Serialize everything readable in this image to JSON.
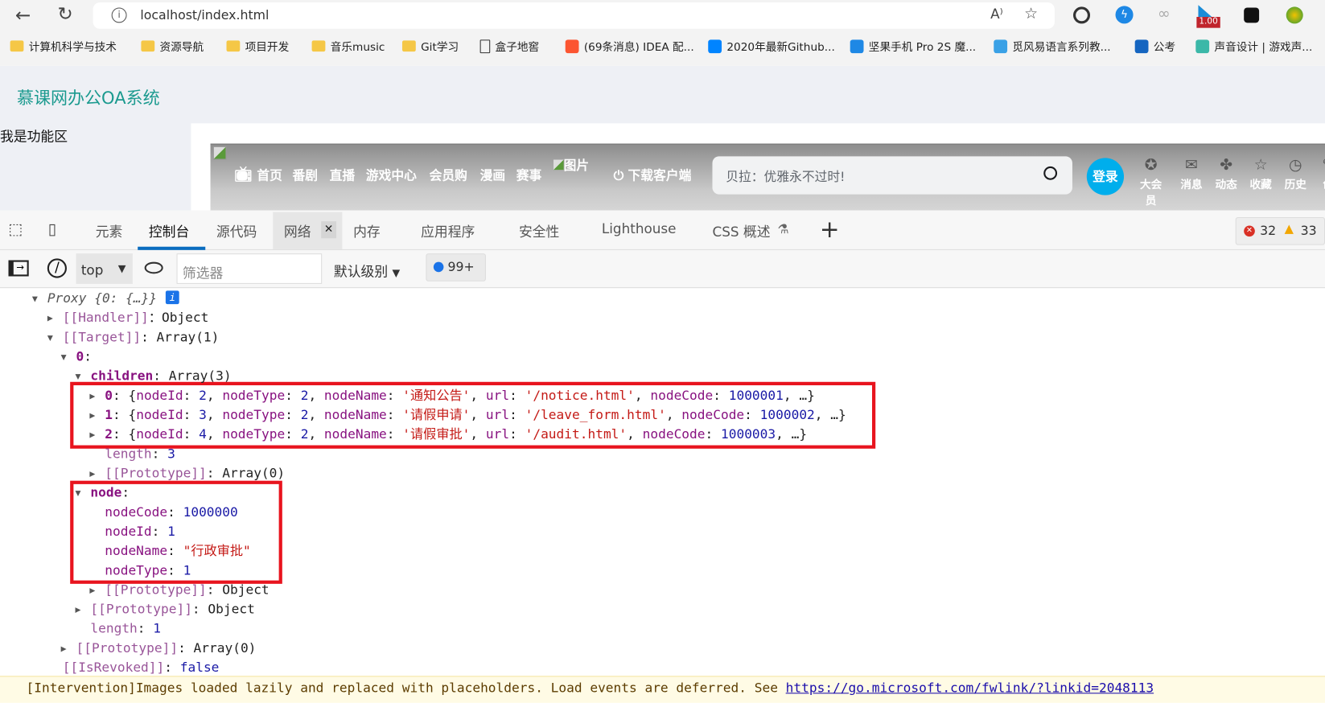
{
  "browser": {
    "url": "localhost/index.html",
    "ext_badge": "1.00",
    "bookmarks": [
      "计算机科学与技术",
      "资源导航",
      "项目开发",
      "音乐music",
      "Git学习",
      "盒子地窖",
      "(69条消息) IDEA 配...",
      "2020年最新Github...",
      "坚果手机 Pro 2S 魔...",
      "觅风易语言系列教...",
      "公考",
      "声音设计 | 游戏声..."
    ]
  },
  "page": {
    "title": "慕课网办公OA系统",
    "sidebar": "我是功能区",
    "bili": {
      "nav": [
        "首页",
        "番剧",
        "直播",
        "游戏中心",
        "会员购",
        "漫画",
        "赛事"
      ],
      "img_alt": "图片",
      "download": "下载客户端",
      "search_placeholder": "贝拉：优雅永不过时!",
      "login": "登录",
      "user_icons": [
        "大会员",
        "消息",
        "动态",
        "收藏",
        "历史",
        "创"
      ]
    }
  },
  "devtools": {
    "tabs": [
      "元素",
      "控制台",
      "源代码",
      "网络",
      "内存",
      "应用程序",
      "安全性",
      "Lighthouse",
      "CSS 概述"
    ],
    "active_tab": "控制台",
    "errors": "32",
    "warnings": "33",
    "toolbar": {
      "context": "top",
      "filter_placeholder": "筛选器",
      "level": "默认级别",
      "messages": "99+"
    },
    "console": [
      {
        "i": 0,
        "t": "open",
        "p": [
          [
            "g",
            "Proxy {0: {…}}"
          ]
        ]
      },
      {
        "i": 1,
        "t": "closed",
        "p": [
          [
            "ki",
            "[[Handler]]"
          ],
          [
            "",
            "：Object"
          ]
        ]
      },
      {
        "i": 1,
        "t": "open",
        "p": [
          [
            "ki",
            "[[Target]]"
          ],
          [
            "",
            ": Array(1)"
          ]
        ]
      },
      {
        "i": 2,
        "t": "open",
        "p": [
          [
            "kb",
            "0"
          ],
          [
            "",
            ":"
          ]
        ]
      },
      {
        "i": 3,
        "t": "open",
        "p": [
          [
            "kb",
            "children"
          ],
          [
            "",
            ": Array(3)"
          ]
        ]
      },
      {
        "i": 4,
        "t": "closed",
        "p": [
          [
            "kb",
            "0"
          ],
          [
            "",
            ": {"
          ],
          [
            "k",
            "nodeId"
          ],
          [
            "",
            ": "
          ],
          [
            "n",
            "2"
          ],
          [
            "",
            ", "
          ],
          [
            "k",
            "nodeType"
          ],
          [
            "",
            ": "
          ],
          [
            "n",
            "2"
          ],
          [
            "",
            ", "
          ],
          [
            "k",
            "nodeName"
          ],
          [
            "",
            ": "
          ],
          [
            "s",
            "'通知公告'"
          ],
          [
            "",
            ", "
          ],
          [
            "k",
            "url"
          ],
          [
            "",
            ": "
          ],
          [
            "s",
            "'/notice.html'"
          ],
          [
            "",
            ", "
          ],
          [
            "k",
            "nodeCode"
          ],
          [
            "",
            ": "
          ],
          [
            "n",
            "1000001"
          ],
          [
            "",
            ", …}"
          ]
        ]
      },
      {
        "i": 4,
        "t": "closed",
        "p": [
          [
            "kb",
            "1"
          ],
          [
            "",
            ": {"
          ],
          [
            "k",
            "nodeId"
          ],
          [
            "",
            ": "
          ],
          [
            "n",
            "3"
          ],
          [
            "",
            ", "
          ],
          [
            "k",
            "nodeType"
          ],
          [
            "",
            ": "
          ],
          [
            "n",
            "2"
          ],
          [
            "",
            ", "
          ],
          [
            "k",
            "nodeName"
          ],
          [
            "",
            ": "
          ],
          [
            "s",
            "'请假申请'"
          ],
          [
            "",
            ", "
          ],
          [
            "k",
            "url"
          ],
          [
            "",
            ": "
          ],
          [
            "s",
            "'/leave_form.html'"
          ],
          [
            "",
            ", "
          ],
          [
            "k",
            "nodeCode"
          ],
          [
            "",
            ": "
          ],
          [
            "n",
            "1000002"
          ],
          [
            "",
            ", …}"
          ]
        ]
      },
      {
        "i": 4,
        "t": "closed",
        "p": [
          [
            "kb",
            "2"
          ],
          [
            "",
            ": {"
          ],
          [
            "k",
            "nodeId"
          ],
          [
            "",
            ": "
          ],
          [
            "n",
            "4"
          ],
          [
            "",
            ", "
          ],
          [
            "k",
            "nodeType"
          ],
          [
            "",
            ": "
          ],
          [
            "n",
            "2"
          ],
          [
            "",
            ", "
          ],
          [
            "k",
            "nodeName"
          ],
          [
            "",
            ": "
          ],
          [
            "s",
            "'请假审批'"
          ],
          [
            "",
            ", "
          ],
          [
            "k",
            "url"
          ],
          [
            "",
            ": "
          ],
          [
            "s",
            "'/audit.html'"
          ],
          [
            "",
            ", "
          ],
          [
            "k",
            "nodeCode"
          ],
          [
            "",
            ": "
          ],
          [
            "n",
            "1000003"
          ],
          [
            "",
            ", …}"
          ]
        ]
      },
      {
        "i": 4,
        "t": null,
        "p": [
          [
            "ki",
            "length"
          ],
          [
            "",
            ": "
          ],
          [
            "n",
            "3"
          ]
        ]
      },
      {
        "i": 4,
        "t": "closed",
        "p": [
          [
            "ki",
            "[[Prototype]]"
          ],
          [
            "",
            ": Array(0)"
          ]
        ]
      },
      {
        "i": 3,
        "t": "open",
        "p": [
          [
            "kb",
            "node"
          ],
          [
            "",
            ":"
          ]
        ]
      },
      {
        "i": 4,
        "t": null,
        "p": [
          [
            "k",
            "nodeCode"
          ],
          [
            "",
            ": "
          ],
          [
            "n",
            "1000000"
          ]
        ]
      },
      {
        "i": 4,
        "t": null,
        "p": [
          [
            "k",
            "nodeId"
          ],
          [
            "",
            ": "
          ],
          [
            "n",
            "1"
          ]
        ]
      },
      {
        "i": 4,
        "t": null,
        "p": [
          [
            "k",
            "nodeName"
          ],
          [
            "",
            ": "
          ],
          [
            "s",
            "\"行政审批\""
          ]
        ]
      },
      {
        "i": 4,
        "t": null,
        "p": [
          [
            "k",
            "nodeType"
          ],
          [
            "",
            ": "
          ],
          [
            "n",
            "1"
          ]
        ]
      },
      {
        "i": 4,
        "t": "closed",
        "p": [
          [
            "ki",
            "[[Prototype]]"
          ],
          [
            "",
            ": Object"
          ]
        ]
      },
      {
        "i": 3,
        "t": "closed",
        "p": [
          [
            "ki",
            "[[Prototype]]"
          ],
          [
            "",
            ": Object"
          ]
        ]
      },
      {
        "i": 3,
        "t": null,
        "p": [
          [
            "ki",
            "length"
          ],
          [
            "",
            ": "
          ],
          [
            "n",
            "1"
          ]
        ]
      },
      {
        "i": 2,
        "t": "closed",
        "p": [
          [
            "ki",
            "[[Prototype]]"
          ],
          [
            "",
            ": Array(0)"
          ]
        ]
      },
      {
        "i": 1,
        "t": null,
        "p": [
          [
            "ki",
            "[[IsRevoked]]"
          ],
          [
            "",
            ": "
          ],
          [
            "n",
            "false"
          ]
        ]
      }
    ],
    "intervention": {
      "text": "[Intervention]Images loaded lazily and replaced with placeholders. Load events are deferred. See ",
      "link": "https://go.microsoft.com/fwlink/?linkid=2048113"
    }
  }
}
